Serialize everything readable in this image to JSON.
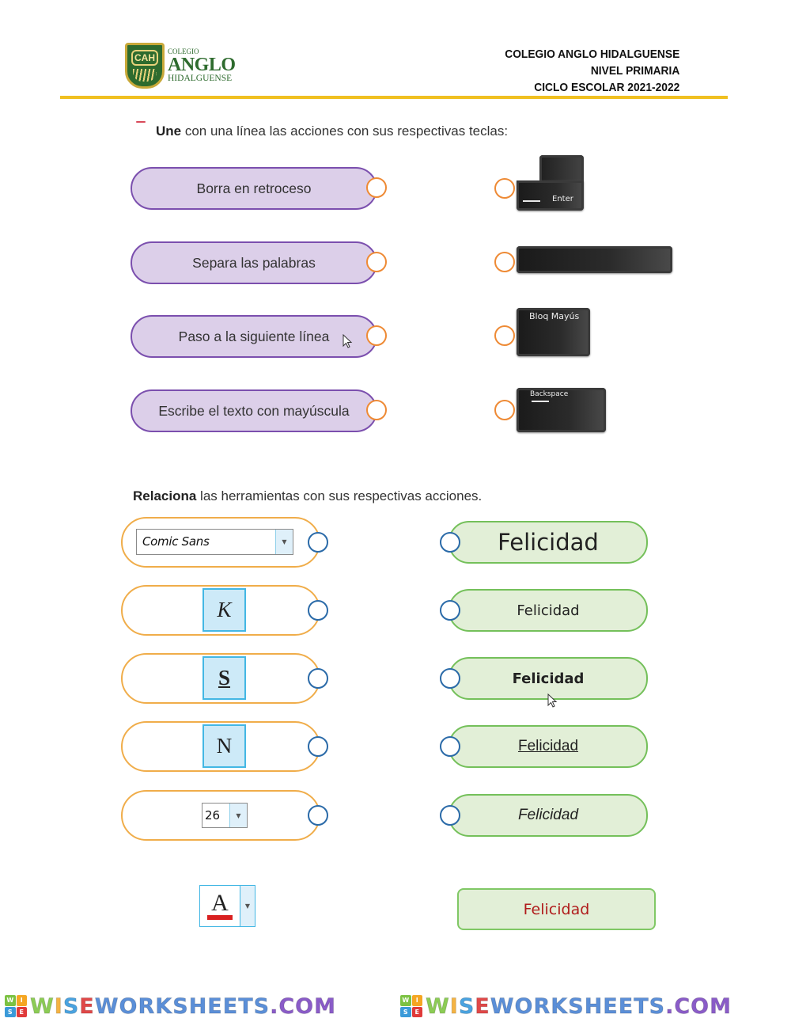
{
  "header": {
    "logo": {
      "emblem_text": "CAH",
      "line1": "COLEGIO",
      "line2": "ANGLO",
      "line3": "HIDALGUENSE"
    },
    "school_name": "COLEGIO ANGLO HIDALGUENSE",
    "level": "NIVEL PRIMARIA",
    "school_year": "CICLO ESCOLAR 2021-2022",
    "accent_color": "#f0c020"
  },
  "section1": {
    "instruction_bold": "Une",
    "instruction_rest": " con una línea las acciones con sus respectivas teclas:",
    "actions": [
      {
        "label": "Borra en retroceso"
      },
      {
        "label": "Separa las palabras"
      },
      {
        "label": "Paso a la siguiente línea"
      },
      {
        "label": "Escribe el texto con mayúscula"
      }
    ],
    "keys": [
      {
        "name": "enter",
        "label": "Enter"
      },
      {
        "name": "space",
        "label": ""
      },
      {
        "name": "caps-lock",
        "label": "Bloq Mayús"
      },
      {
        "name": "backspace",
        "label": "Backspace"
      }
    ],
    "colors": {
      "pill_border": "#7b4fae",
      "pill_fill": "#dccfe9",
      "dot": "#ee8a35"
    }
  },
  "section2": {
    "instruction_bold": "Relaciona",
    "instruction_rest": " las herramientas con sus respectivas acciones.",
    "tools": [
      {
        "name": "font-selector",
        "value": "Comic Sans"
      },
      {
        "name": "italic-button",
        "label": "K"
      },
      {
        "name": "underline-button",
        "label": "S"
      },
      {
        "name": "bold-button",
        "label": "N"
      },
      {
        "name": "font-size-selector",
        "value": "26"
      }
    ],
    "results": [
      {
        "label": "Felicidad",
        "style": "large"
      },
      {
        "label": "Felicidad",
        "style": "comic"
      },
      {
        "label": "Felicidad",
        "style": "bold"
      },
      {
        "label": "Felicidad",
        "style": "underline"
      },
      {
        "label": "Felicidad",
        "style": "italic"
      }
    ],
    "extra_tool": {
      "name": "font-color-button",
      "label": "A",
      "color": "#d92020"
    },
    "extra_result": {
      "label": "Felicidad",
      "color": "#b01c1c"
    },
    "colors": {
      "tool_border": "#f0ad4a",
      "result_border": "#74c05a",
      "result_fill": "#e2efd7",
      "dot": "#2a6aa8"
    }
  },
  "footer": {
    "watermark": "WISEWORKSHEETS.COM",
    "logo_letters": [
      "W",
      "I",
      "S",
      "E"
    ]
  }
}
